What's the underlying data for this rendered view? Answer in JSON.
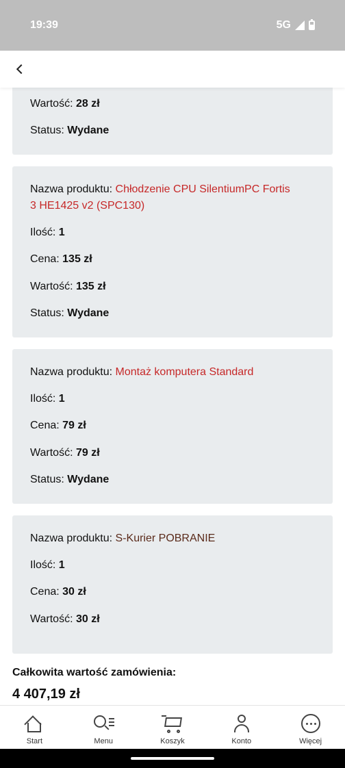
{
  "status_bar": {
    "time": "19:39",
    "network": "5G"
  },
  "items": [
    {
      "rows": [
        {
          "label": "Wartość: ",
          "value": "28 zł"
        },
        {
          "label": "Status: ",
          "value": "Wydane"
        }
      ]
    },
    {
      "name_label": "Nazwa produktu: ",
      "name_line1": "Chłodzenie CPU SilentiumPC Fortis",
      "name_line2": "3 HE1425 v2 (SPC130)",
      "rows": [
        {
          "label": "Ilość: ",
          "value": "1"
        },
        {
          "label": "Cena: ",
          "value": "135 zł"
        },
        {
          "label": "Wartość: ",
          "value": "135 zł"
        },
        {
          "label": "Status: ",
          "value": "Wydane"
        }
      ]
    },
    {
      "name_label": "Nazwa produktu: ",
      "name_line1": "Montaż komputera Standard",
      "rows": [
        {
          "label": "Ilość: ",
          "value": "1"
        },
        {
          "label": "Cena: ",
          "value": "79 zł"
        },
        {
          "label": "Wartość: ",
          "value": "79 zł"
        },
        {
          "label": "Status: ",
          "value": "Wydane"
        }
      ]
    },
    {
      "name_label": "Nazwa produktu: ",
      "name_line1": "S-Kurier POBRANIE",
      "rows": [
        {
          "label": "Ilość: ",
          "value": "1"
        },
        {
          "label": "Cena: ",
          "value": "30 zł"
        },
        {
          "label": "Wartość: ",
          "value": "30 zł"
        }
      ]
    }
  ],
  "total": {
    "label": "Całkowita wartość zamówienia:",
    "value": "4 407,19 zł"
  },
  "bottom_nav": [
    {
      "label": "Start",
      "icon": "home-icon"
    },
    {
      "label": "Menu",
      "icon": "menu-search-icon"
    },
    {
      "label": "Koszyk",
      "icon": "cart-icon"
    },
    {
      "label": "Konto",
      "icon": "user-icon"
    },
    {
      "label": "Więcej",
      "icon": "more-icon"
    }
  ],
  "colors": {
    "accent": "#c62828",
    "card_bg": "#e9ecee",
    "status_bar_bg": "#bdbdbd"
  }
}
